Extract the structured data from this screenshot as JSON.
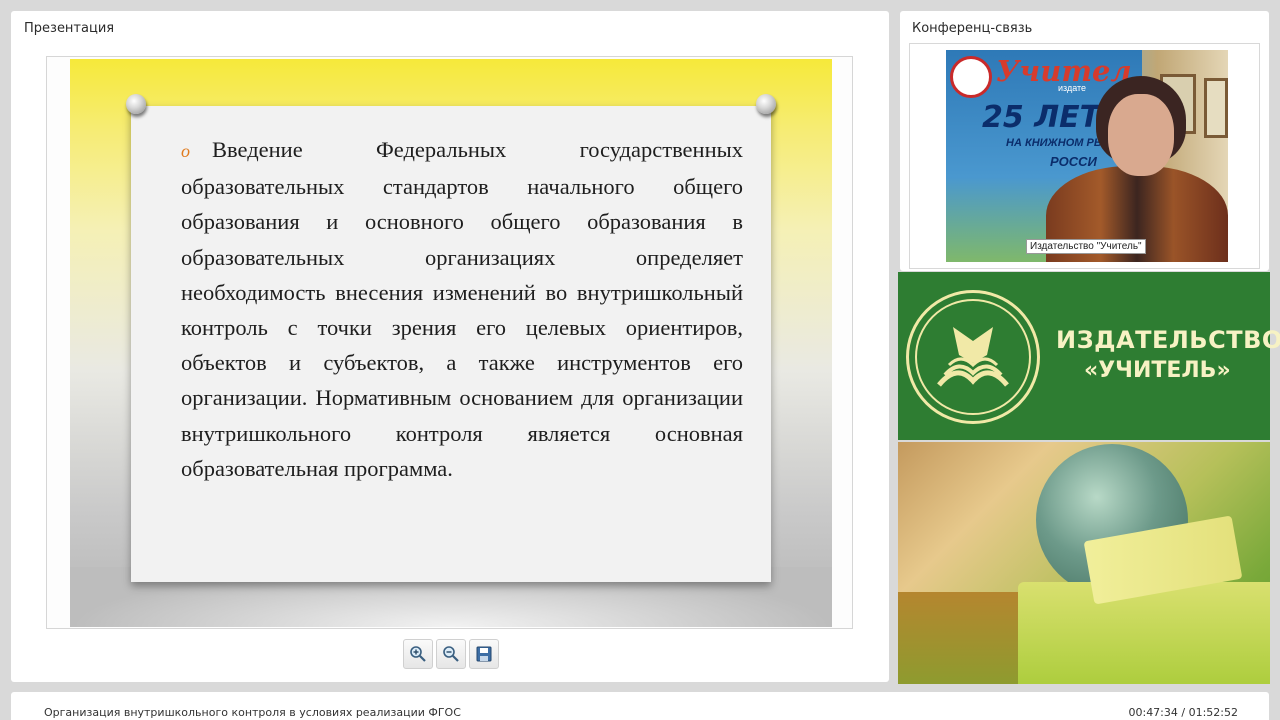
{
  "presentation": {
    "title": "Презентация",
    "slide": {
      "bullet": "o",
      "text": "Введение Федеральных государственных образовательных стандартов начального общего образования и основного общего образования в образовательных организациях определяет необходимость внесения изменений во внутришкольный контроль с точки зрения его целевых ориентиров, объектов и субъектов, а также инструментов его организации. Нормативным основанием для организации внутришкольного контроля является основная образовательная программа."
    },
    "toolbar": {
      "zoom_in_icon": "zoom-in-icon",
      "zoom_out_icon": "zoom-out-icon",
      "save_icon": "save-icon"
    }
  },
  "conference": {
    "title": "Конференц-связь",
    "video_caption": "Издательство \"Учитель\"",
    "poster": {
      "brand": "Учител",
      "sub": "издате",
      "big": "25 ЛЕТ",
      "line1": "НА КНИЖНОМ РЫН",
      "line2": "РОССИ"
    }
  },
  "publisher": {
    "name_line1": "ИЗДАТЕЛЬСТВО",
    "name_line2": "«УЧИТЕЛЬ»",
    "colors": {
      "background": "#2e7d32",
      "text": "#f7f2c4"
    }
  },
  "footer": {
    "lecture_title": "Организация внутришкольного контроля в условиях реализации ФГОС",
    "time": "00:47:34 / 01:52:52"
  }
}
